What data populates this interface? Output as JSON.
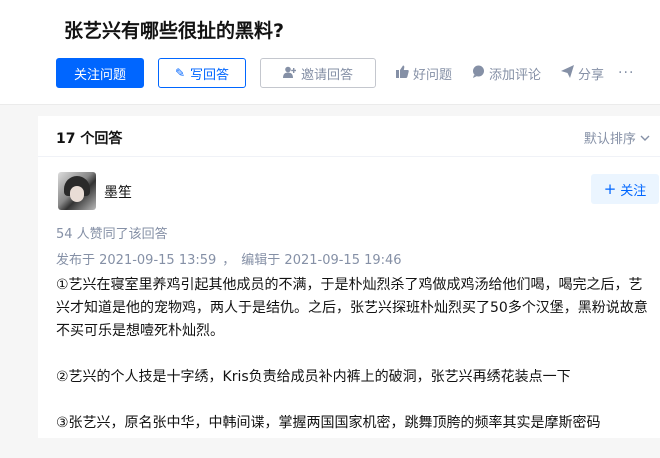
{
  "question": {
    "title": "张艺兴有哪些很扯的黑料?"
  },
  "actions": {
    "follow_question": "关注问题",
    "write_answer": "写回答",
    "invite_answer": "邀请回答",
    "good_question": "好问题",
    "add_comment": "添加评论",
    "share": "分享",
    "more": "···"
  },
  "answers_header": {
    "count": "17 个回答",
    "sort": "默认排序"
  },
  "answer": {
    "author": "墨笙",
    "follow": "关注",
    "votes": "54 人赞同了该回答",
    "published": "发布于 2021-09-15 13:59",
    "edited": "编辑于 2021-09-15 19:46",
    "paragraphs": [
      "①艺兴在寝室里养鸡引起其他成员的不满，于是朴灿烈杀了鸡做成鸡汤给他们喝，喝完之后，艺兴才知道是他的宠物鸡，两人于是结仇。之后，张艺兴探班朴灿烈买了50多个汉堡，黑粉说故意不买可乐是想噎死朴灿烈。",
      "②艺兴的个人技是十字绣，Kris负责给成员补内裤上的破洞，张艺兴再绣花装点一下",
      "③张艺兴，原名张中华，中韩间谍，掌握两国国家机密，跳舞顶胯的频率其实是摩斯密码"
    ]
  },
  "colors": {
    "primary": "#0066ff",
    "muted": "#8590a6",
    "text": "#121212",
    "background": "#f6f6f6"
  }
}
